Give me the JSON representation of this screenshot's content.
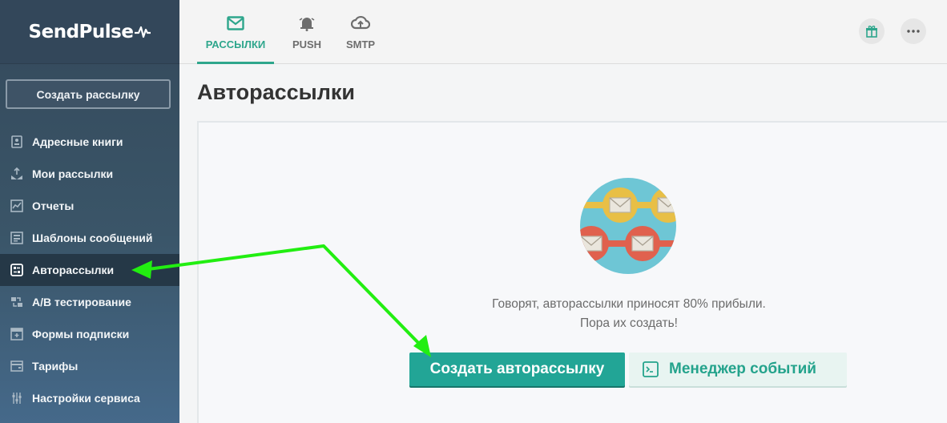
{
  "brand": {
    "name": "SendPulse"
  },
  "sidebar": {
    "create_label": "Создать рассылку",
    "items": [
      {
        "label": "Адресные книги",
        "icon": "address-book-icon"
      },
      {
        "label": "Мои рассылки",
        "icon": "mail-send-icon"
      },
      {
        "label": "Отчеты",
        "icon": "chart-icon"
      },
      {
        "label": "Шаблоны сообщений",
        "icon": "template-icon"
      },
      {
        "label": "Авторассылки",
        "icon": "automation-icon",
        "active": true
      },
      {
        "label": "A/B тестирование",
        "icon": "ab-test-icon"
      },
      {
        "label": "Формы подписки",
        "icon": "form-icon"
      },
      {
        "label": "Тарифы",
        "icon": "wallet-icon"
      },
      {
        "label": "Настройки сервиса",
        "icon": "settings-sliders-icon"
      }
    ]
  },
  "topbar": {
    "tabs": [
      {
        "label": "РАССЫЛКИ",
        "icon": "mail-icon",
        "active": true
      },
      {
        "label": "PUSH",
        "icon": "bell-icon"
      },
      {
        "label": "SMTP",
        "icon": "cloud-upload-icon"
      }
    ],
    "gift_icon": "gift-icon",
    "more_icon": "more-dots-icon"
  },
  "main": {
    "title": "Авторассылки",
    "message_line1": "Говорят, авторассылки приносят 80% прибыли.",
    "message_line2": "Пора их создать!",
    "primary_button": "Создать авторассылку",
    "secondary_button": "Менеджер событий"
  },
  "colors": {
    "accent": "#2ea68c",
    "button": "#22a596",
    "sidebar": "#34495b",
    "annotation_arrow": "#22ee11"
  }
}
